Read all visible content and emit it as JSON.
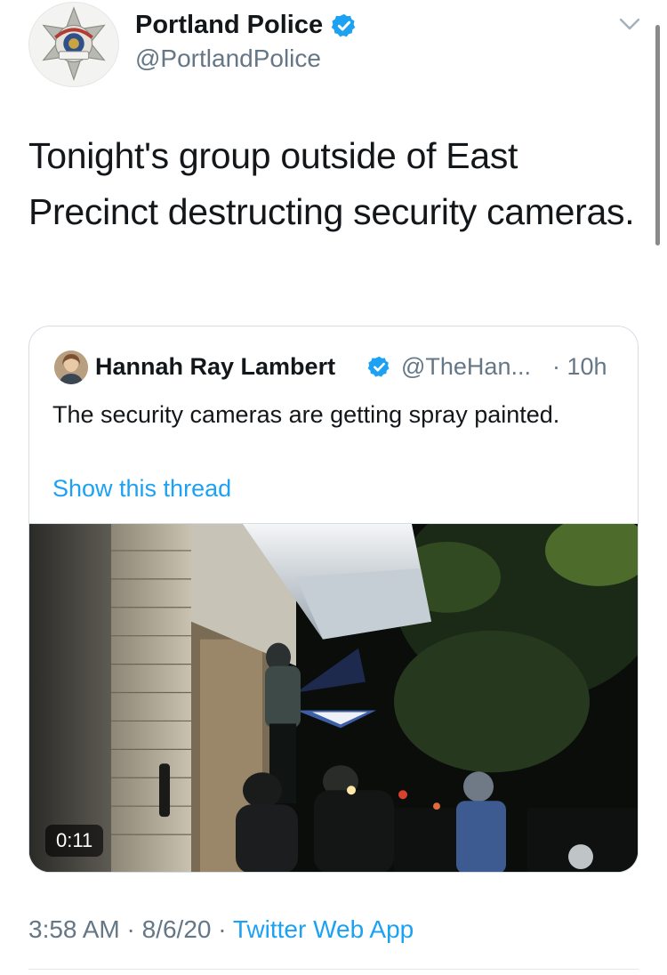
{
  "author": {
    "display_name": "Portland Police",
    "handle": "@PortlandPolice",
    "verified": true,
    "avatar_badge_text": [
      "OFFICER",
      "PORTLAND",
      "POLICE"
    ],
    "avatar_icon": "police-star-badge"
  },
  "tweet": {
    "text": "Tonight's group outside of East Precinct destructing security cameras."
  },
  "quoted": {
    "display_name": "Hannah Ray Lambert",
    "handle": "@TheHan...",
    "time": "· 10h",
    "verified": true,
    "text": "The security cameras are getting spray painted.",
    "show_thread": "Show this thread",
    "video_duration": "0:11"
  },
  "meta": {
    "time": "3:58 AM",
    "separator": "·",
    "date": "8/6/20",
    "app": "Twitter Web App"
  },
  "colors": {
    "link": "#1da1f2",
    "secondary_text": "#657786",
    "verified": "#1da1f2",
    "border": "#d6dde3"
  },
  "icons": {
    "verified": "verified-badge-icon",
    "caret": "chevron-down-icon"
  }
}
